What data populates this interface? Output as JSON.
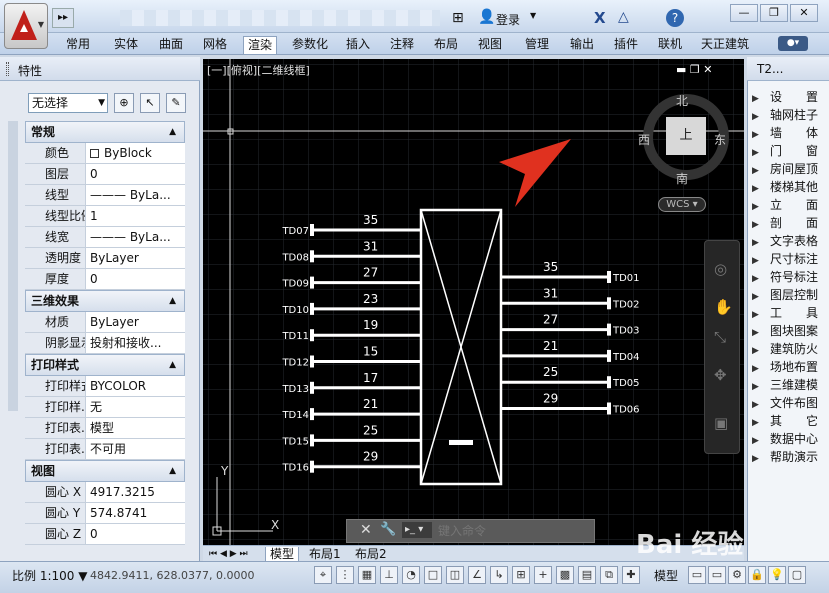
{
  "titlebar": {
    "login": "登录",
    "help": "?",
    "minimize": "—",
    "restore": "❐",
    "close": "✕"
  },
  "ribbon": {
    "tabs": [
      "常用",
      "实体",
      "曲面",
      "网格",
      "渲染",
      "参数化",
      "插入",
      "注释",
      "布局",
      "视图",
      "管理",
      "输出",
      "插件",
      "联机",
      "天正建筑"
    ],
    "active": "渲染"
  },
  "palette": {
    "title": "特性",
    "selection": "无选择",
    "sections": [
      {
        "title": "常规",
        "rows": [
          {
            "k": "颜色",
            "v": "ByBlock"
          },
          {
            "k": "图层",
            "v": "0"
          },
          {
            "k": "线型",
            "v": "——— ByLa..."
          },
          {
            "k": "线型比例",
            "v": "1"
          },
          {
            "k": "线宽",
            "v": "——— ByLa..."
          },
          {
            "k": "透明度",
            "v": "ByLayer"
          },
          {
            "k": "厚度",
            "v": "0"
          }
        ]
      },
      {
        "title": "三维效果",
        "rows": [
          {
            "k": "材质",
            "v": "ByLayer"
          },
          {
            "k": "阴影显示",
            "v": "投射和接收..."
          }
        ]
      },
      {
        "title": "打印样式",
        "rows": [
          {
            "k": "打印样式",
            "v": "BYCOLOR"
          },
          {
            "k": "打印样...",
            "v": "无"
          },
          {
            "k": "打印表...",
            "v": "模型"
          },
          {
            "k": "打印表...",
            "v": "不可用"
          }
        ]
      },
      {
        "title": "视图",
        "rows": [
          {
            "k": "圆心 X ...",
            "v": "4917.3215"
          },
          {
            "k": "圆心 Y ...",
            "v": "574.8741"
          },
          {
            "k": "圆心 Z ...",
            "v": "0"
          }
        ]
      }
    ]
  },
  "viewport": {
    "label": "[一][俯视][二维线框]",
    "compass": {
      "n": "北",
      "s": "南",
      "e": "东",
      "w": "西",
      "top": "上"
    },
    "wcs": "WCS",
    "left_pins": [
      {
        "label": "TD07",
        "value": "35"
      },
      {
        "label": "TD08",
        "value": "31"
      },
      {
        "label": "TD09",
        "value": "27"
      },
      {
        "label": "TD10",
        "value": "23"
      },
      {
        "label": "TD11",
        "value": "19"
      },
      {
        "label": "TD12",
        "value": "15"
      },
      {
        "label": "TD13",
        "value": "17"
      },
      {
        "label": "TD14",
        "value": "21"
      },
      {
        "label": "TD15",
        "value": "25"
      },
      {
        "label": "TD16",
        "value": "29"
      }
    ],
    "right_pins": [
      {
        "label": "TD01",
        "value": "35"
      },
      {
        "label": "TD02",
        "value": "31"
      },
      {
        "label": "TD03",
        "value": "27"
      },
      {
        "label": "TD04",
        "value": "21"
      },
      {
        "label": "TD05",
        "value": "25"
      },
      {
        "label": "TD06",
        "value": "29"
      }
    ],
    "ucs_x": "X",
    "ucs_y": "Y"
  },
  "command": {
    "placeholder": "键入命令"
  },
  "layout_tabs": [
    "模型",
    "布局1",
    "布局2"
  ],
  "tool2": {
    "title": "T2...",
    "items": [
      "设　　置",
      "轴网柱子",
      "墙　　体",
      "门　　窗",
      "房间屋顶",
      "楼梯其他",
      "立　　面",
      "剖　　面",
      "文字表格",
      "尺寸标注",
      "符号标注",
      "图层控制",
      "工　　具",
      "图块图案",
      "建筑防火",
      "场地布置",
      "三维建模",
      "文件布图",
      "其　　它",
      "数据中心",
      "帮助演示"
    ]
  },
  "status": {
    "scale": "比例 1:100",
    "coords": "4842.9411,  628.0377,  0.0000",
    "model": "模型"
  },
  "watermark": "Bai 经验"
}
